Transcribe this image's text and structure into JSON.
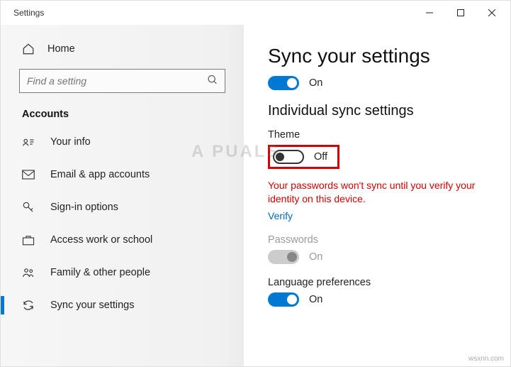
{
  "window": {
    "title": "Settings"
  },
  "sidebar": {
    "home": "Home",
    "search_placeholder": "Find a setting",
    "section": "Accounts",
    "items": [
      {
        "label": "Your info"
      },
      {
        "label": "Email & app accounts"
      },
      {
        "label": "Sign-in options"
      },
      {
        "label": "Access work or school"
      },
      {
        "label": "Family & other people"
      },
      {
        "label": "Sync your settings"
      }
    ]
  },
  "main": {
    "title": "Sync your settings",
    "master_toggle": {
      "state": "On"
    },
    "subheading": "Individual sync settings",
    "theme": {
      "label": "Theme",
      "state": "Off"
    },
    "warning": "Your passwords won't sync until you verify your identity on this device.",
    "verify": "Verify",
    "passwords": {
      "label": "Passwords",
      "state": "On"
    },
    "language": {
      "label": "Language preferences",
      "state": "On"
    }
  },
  "watermark": {
    "corner": "wsxnn.com",
    "center": "A  PUALS"
  }
}
